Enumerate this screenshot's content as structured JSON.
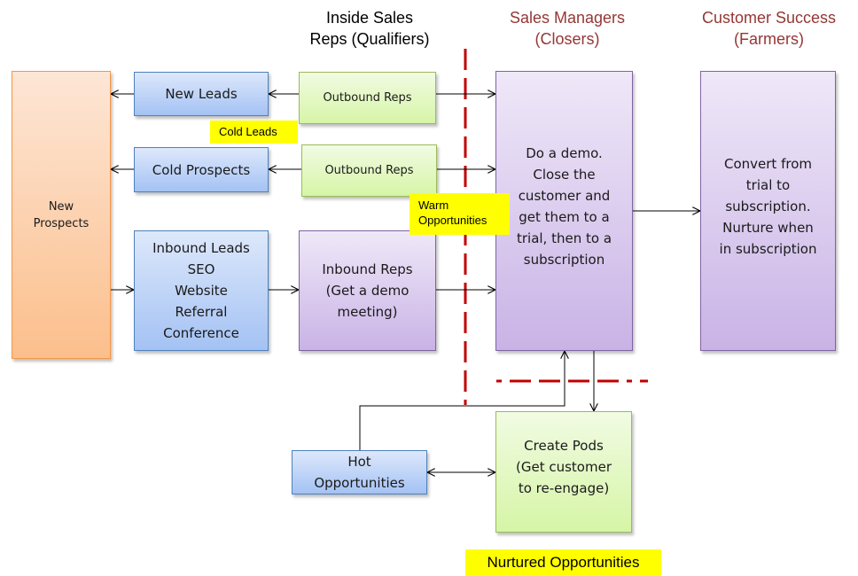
{
  "column_titles": {
    "inside_sales": "Inside Sales\nReps (Qualifiers)",
    "sales_managers": "Sales Managers\n(Closers)",
    "customer_success": "Customer Success\n(Farmers)"
  },
  "boxes": {
    "new_prospects": "New\nProspects",
    "new_leads": "New Leads",
    "cold_prospects": "Cold Prospects",
    "inbound_leads": "Inbound Leads\nSEO\nWebsite\nReferral\nConference",
    "outbound_reps_1": "Outbound Reps",
    "outbound_reps_2": "Outbound Reps",
    "inbound_reps": "Inbound Reps\n(Get a demo\nmeeting)",
    "sales_managers": "Do a demo.\nClose the\ncustomer and\nget them to a\ntrial, then to a\nsubscription",
    "customer_success": "Convert from\ntrial to\nsubscription.\nNurture when\nin subscription",
    "hot_opportunities": "Hot\nOpportunities",
    "create_pods": "Create Pods\n(Get customer\nto re-engage)"
  },
  "labels": {
    "cold_leads": "Cold Leads",
    "warm_opportunities": "Warm\nOpportunities",
    "nurtured_opportunities": "Nurtured Opportunities"
  },
  "colors": {
    "column_title_accent": "#953735",
    "divider_red": "#C00000",
    "highlight_yellow": "#FFFF00",
    "prospect_orange": "#F79646",
    "lead_blue": "#4F81BD",
    "rep_green": "#9BBB59",
    "closer_purple": "#8064A2"
  }
}
